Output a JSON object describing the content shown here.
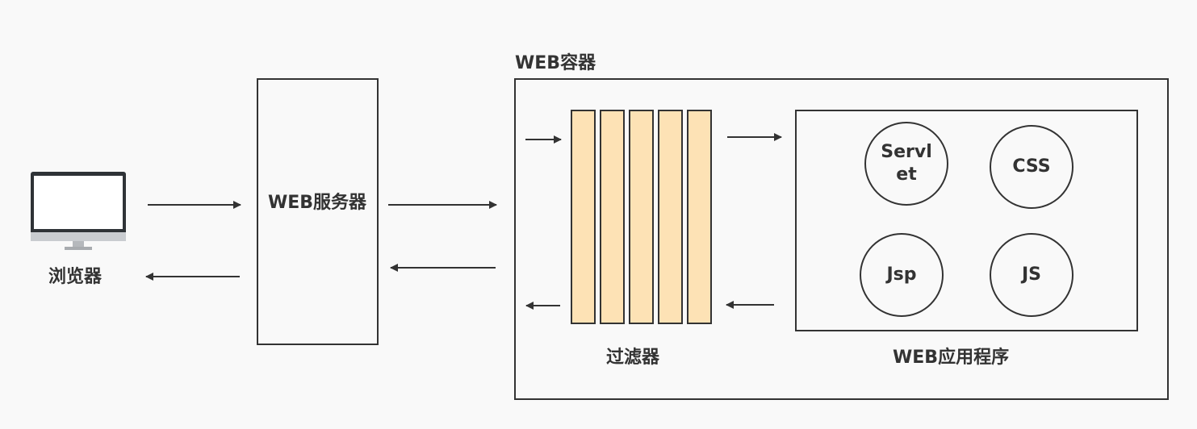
{
  "browser": {
    "label": "浏览器",
    "icon": "monitor-icon"
  },
  "web_server": {
    "label": "WEB服务器"
  },
  "web_container": {
    "label": "WEB容器"
  },
  "filter": {
    "label": "过滤器",
    "fill_color": "#fde2b5"
  },
  "web_app": {
    "label": "WEB应用程序",
    "components": [
      "Servlet",
      "CSS",
      "Jsp",
      "JS"
    ]
  },
  "colors": {
    "stroke": "#333333",
    "background": "#f9f9f9"
  }
}
